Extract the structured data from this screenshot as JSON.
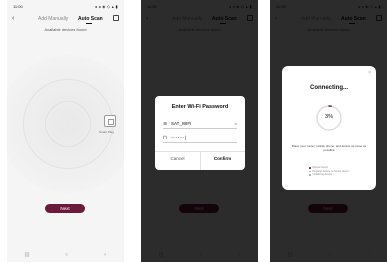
{
  "status": {
    "time": "11:00",
    "icons": "◂ ◂ ◈ ◇ ▴ ▮"
  },
  "header": {
    "back": "‹",
    "tab_manual": "Add Manually",
    "tab_auto": "Auto Scan"
  },
  "scan": {
    "subtitle": "Available devices found",
    "device_label": "Smart Plug"
  },
  "actions": {
    "next": "Next"
  },
  "nav": {
    "recent": "|||",
    "home": "○",
    "back": "‹"
  },
  "wifi_dialog": {
    "title": "Enter Wi-Fi Password",
    "ssid": "SAT_WIFI",
    "ssid_tail": "⇄",
    "password": "------|",
    "password_tail": "···",
    "cancel": "Cancel",
    "confirm": "Confirm"
  },
  "connecting": {
    "title": "Connecting...",
    "percent": "3%",
    "progress": 0.03,
    "message": "Place your router, mobile phone, and device as close as possible",
    "steps": [
      "Device found",
      "Register device to Smart Cloud",
      "Initializing device..."
    ],
    "close": "×"
  },
  "colors": {
    "accent": "#6c1a3c",
    "background": "#f5f5f5",
    "overlay": "#1b1b1b"
  }
}
